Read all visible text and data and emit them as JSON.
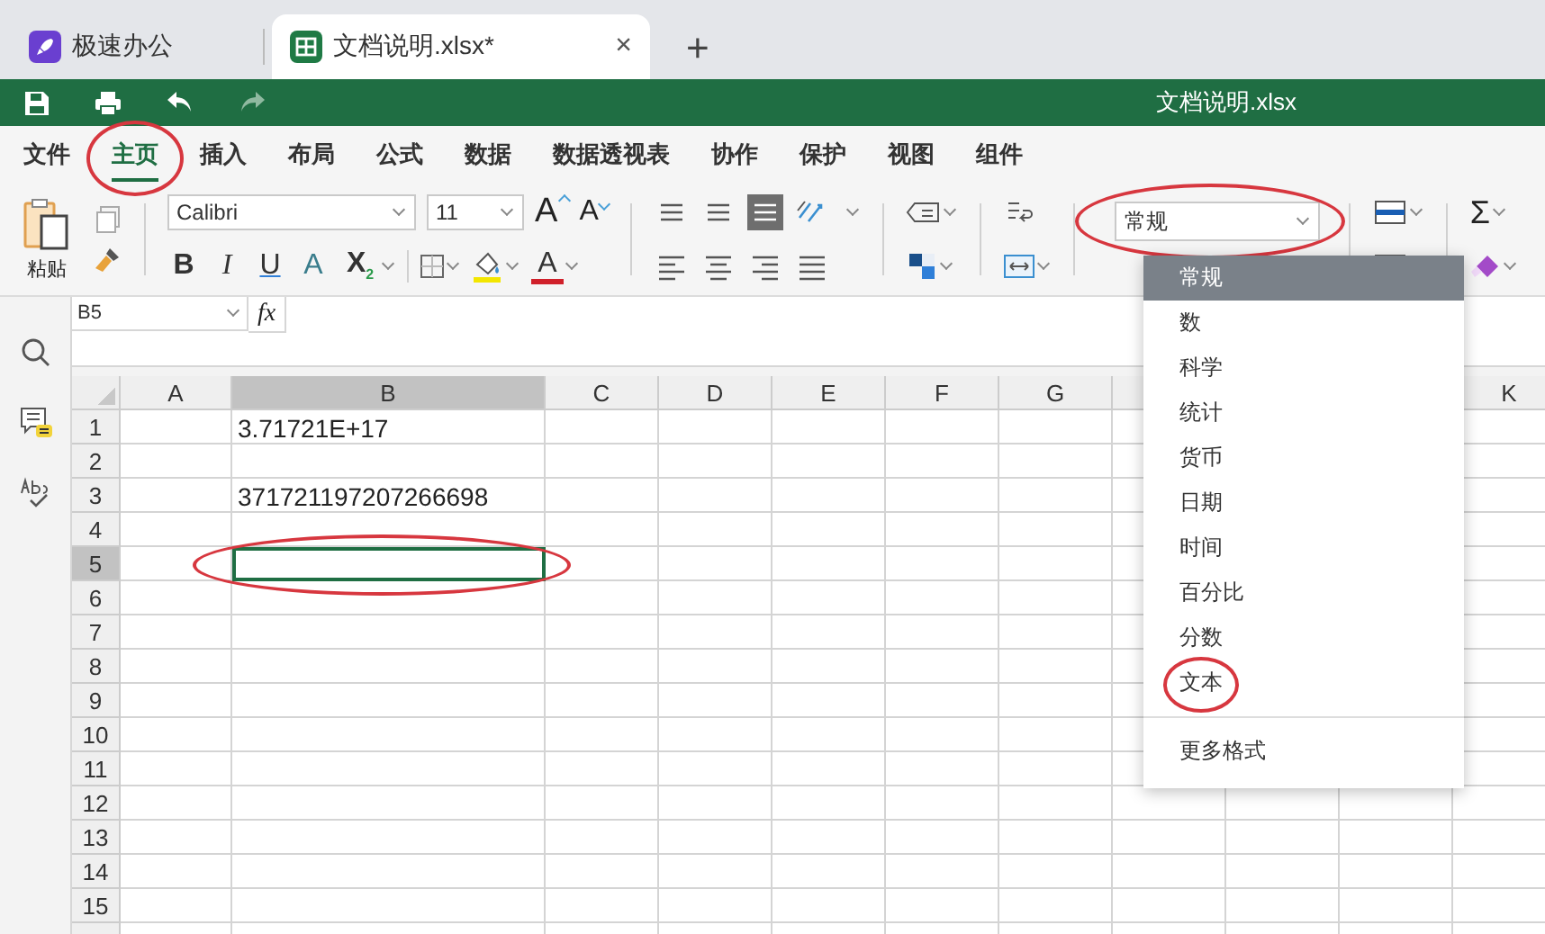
{
  "app_tabs": [
    {
      "label": "极速办公",
      "kind": "home",
      "selected": false
    },
    {
      "label": "文档说明.xlsx*",
      "kind": "sheet",
      "selected": true,
      "close": "×"
    }
  ],
  "new_tab": "+",
  "document_title": "文档说明.xlsx",
  "menu": [
    {
      "label": "文件",
      "selected": false,
      "circled": false
    },
    {
      "label": "主页",
      "selected": true,
      "circled": true
    },
    {
      "label": "插入",
      "selected": false,
      "circled": false
    },
    {
      "label": "布局",
      "selected": false,
      "circled": false
    },
    {
      "label": "公式",
      "selected": false,
      "circled": false
    },
    {
      "label": "数据",
      "selected": false,
      "circled": false
    },
    {
      "label": "数据透视表",
      "selected": false,
      "circled": false
    },
    {
      "label": "协作",
      "selected": false,
      "circled": false
    },
    {
      "label": "保护",
      "selected": false,
      "circled": false
    },
    {
      "label": "视图",
      "selected": false,
      "circled": false
    },
    {
      "label": "组件",
      "selected": false,
      "circled": false
    }
  ],
  "ribbon": {
    "paste_label": "粘贴",
    "font_name": "Calibri",
    "font_size": "11",
    "grow_font": "A",
    "shrink_font": "A",
    "styles": [
      "B",
      "I",
      "U",
      "A"
    ],
    "subscript": "X$_{2}$",
    "font_color": "A",
    "number_format": {
      "value": "常规",
      "circled": true
    },
    "sum": "Σ"
  },
  "name_box": "B5",
  "formula_label": "fx",
  "columns": [
    {
      "label": "A",
      "selected": false
    },
    {
      "label": "B",
      "selected": true
    },
    {
      "label": "C",
      "selected": false
    },
    {
      "label": "D",
      "selected": false
    },
    {
      "label": "E",
      "selected": false
    },
    {
      "label": "F",
      "selected": false
    },
    {
      "label": "G",
      "selected": false
    }
  ],
  "last_column": {
    "label": "K",
    "selected": false
  },
  "rows": [
    {
      "number": "1",
      "selected": false,
      "active": false,
      "circled": false,
      "column_b": "3.71721E+17"
    },
    {
      "number": "2",
      "selected": false,
      "active": false,
      "circled": false
    },
    {
      "number": "3",
      "selected": false,
      "active": false,
      "circled": false,
      "column_b": "371721197207266698"
    },
    {
      "number": "4",
      "selected": false,
      "active": false,
      "circled": false
    },
    {
      "number": "5",
      "selected": true,
      "active": true,
      "circled": true
    },
    {
      "number": "6",
      "selected": false,
      "active": false,
      "circled": false
    },
    {
      "number": "7",
      "selected": false,
      "active": false,
      "circled": false
    },
    {
      "number": "8",
      "selected": false,
      "active": false,
      "circled": false
    },
    {
      "number": "9",
      "selected": false,
      "active": false,
      "circled": false
    },
    {
      "number": "10",
      "selected": false,
      "active": false,
      "circled": false
    },
    {
      "number": "11",
      "selected": false,
      "active": false,
      "circled": false
    },
    {
      "number": "12",
      "selected": false,
      "active": false,
      "circled": false
    },
    {
      "number": "13",
      "selected": false,
      "active": false,
      "circled": false
    },
    {
      "number": "14",
      "selected": false,
      "active": false,
      "circled": false
    },
    {
      "number": "15",
      "selected": false,
      "active": false,
      "circled": false
    }
  ],
  "format_menu": {
    "items": [
      {
        "label": "常规",
        "selected": true,
        "circled": false
      },
      {
        "label": "数",
        "selected": false,
        "circled": false
      },
      {
        "label": "科学",
        "selected": false,
        "circled": false
      },
      {
        "label": "统计",
        "selected": false,
        "circled": false
      },
      {
        "label": "货币",
        "selected": false,
        "circled": false
      },
      {
        "label": "日期",
        "selected": false,
        "circled": false
      },
      {
        "label": "时间",
        "selected": false,
        "circled": false
      },
      {
        "label": "百分比",
        "selected": false,
        "circled": false
      },
      {
        "label": "分数",
        "selected": false,
        "circled": false
      },
      {
        "label": "文本",
        "selected": false,
        "circled": true
      }
    ],
    "more": "更多格式"
  }
}
